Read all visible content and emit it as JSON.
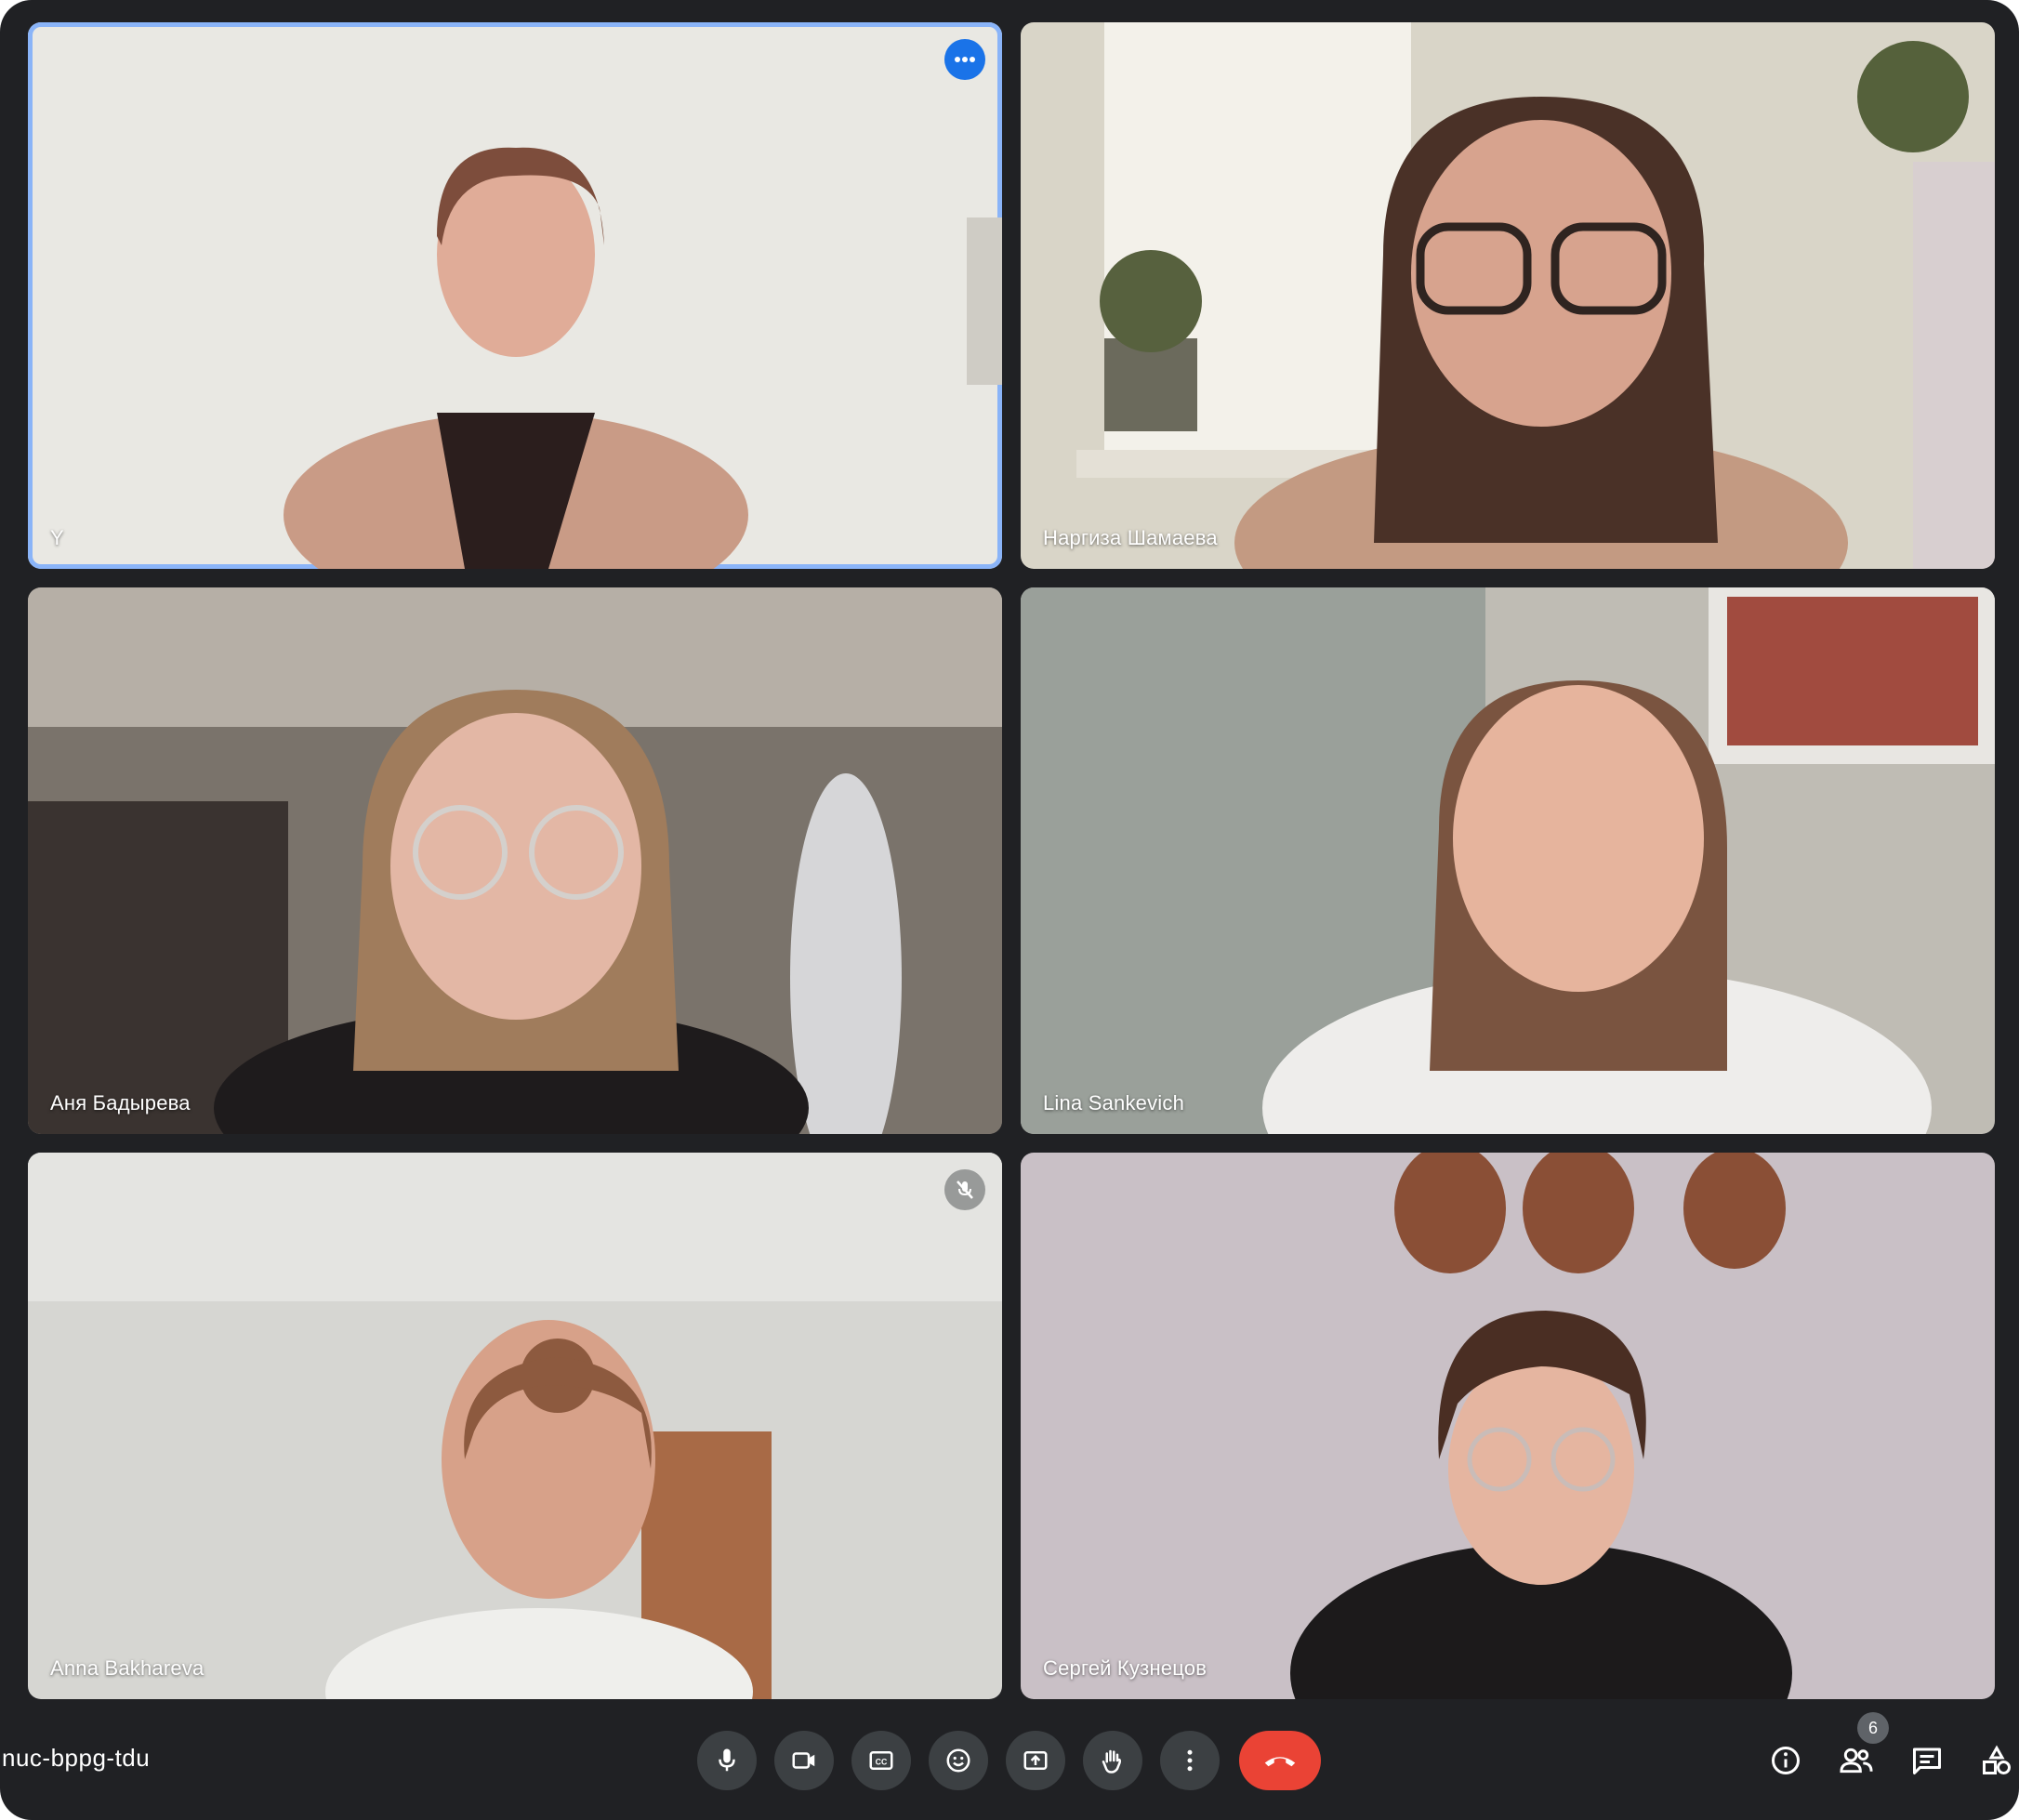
{
  "meeting": {
    "code": "nuc-bppg-tdu",
    "participant_count": "6"
  },
  "tiles": [
    {
      "name": "Y",
      "active": true,
      "background": "#e9e8e3"
    },
    {
      "name": "Наргиза Шамаева",
      "background": "#d9d5c8"
    },
    {
      "name": "Аня Бадырева",
      "background": "#8a837b"
    },
    {
      "name": "Lina Sankevich",
      "background": "#bfbcb4"
    },
    {
      "name": "Anna Bakhareva",
      "background": "#d6d6d2"
    },
    {
      "name": "Сергей Кузнецов",
      "background": "#c9c0c6"
    }
  ],
  "controls": {
    "mic": "microphone-icon",
    "camera": "camera-icon",
    "captions": "captions-icon",
    "reactions": "emoji-icon",
    "present": "present-screen-icon",
    "raise_hand": "hand-icon",
    "more": "more-vert-icon",
    "leave": "end-call-icon"
  },
  "side": {
    "info": "info-icon",
    "people": "people-icon",
    "chat": "chat-icon",
    "activities": "activities-icon"
  },
  "colors": {
    "frame": "#202124",
    "control": "#3c4043",
    "leave": "#ea4335",
    "active_border": "#8ab4f8",
    "accent": "#1a73e8"
  }
}
